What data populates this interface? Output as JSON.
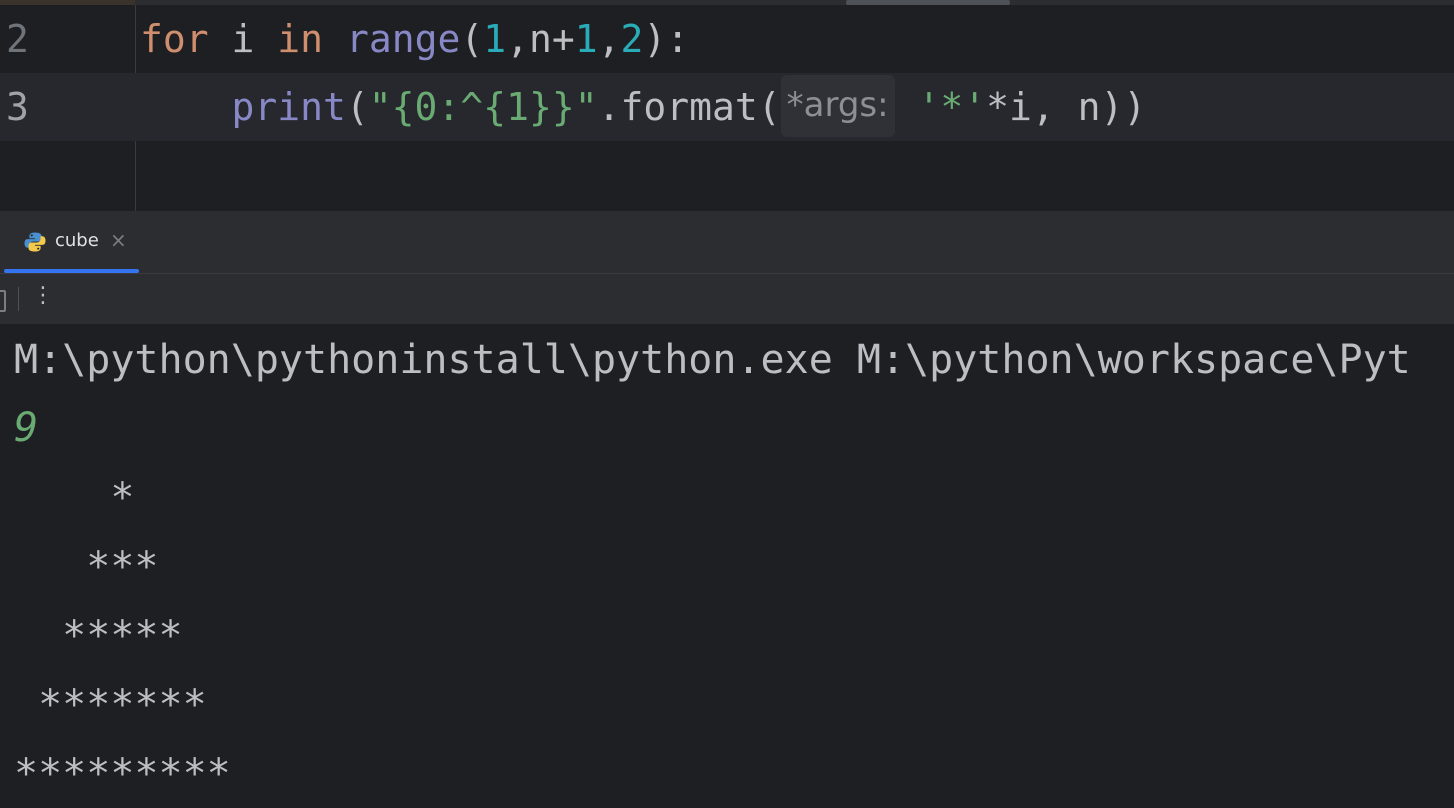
{
  "editor": {
    "lines": [
      {
        "num": "2",
        "tokens": {
          "for": "for",
          "i": " i ",
          "in": "in",
          "range": "range",
          "open": "(",
          "n1": "1",
          "c1": ",n+",
          "n2": "1",
          "c2": ",",
          "n3": "2",
          "close": "):"
        }
      },
      {
        "num": "3",
        "tokens": {
          "indent": "    ",
          "print": "print",
          "p1": "(",
          "str": "\"{0:^{1}}\"",
          "fmt": ".format(",
          "hint": "*args:",
          "sp": " ",
          "star": "'*'",
          "rest": "*i, n))"
        }
      }
    ]
  },
  "run_panel": {
    "tab_label": "cube",
    "tab_close": "×",
    "more_icon": "⋮"
  },
  "console": {
    "lines": [
      "M:\\python\\pythoninstall\\python.exe M:\\python\\workspace\\Pyt",
      "9",
      "    *",
      "   ***",
      "  *****",
      " *******",
      "*********"
    ]
  },
  "colors": {
    "keyword": "#cf8e6d",
    "builtin": "#8888c6",
    "number": "#2aacb8",
    "string": "#6aab73",
    "accent": "#3574f0"
  }
}
